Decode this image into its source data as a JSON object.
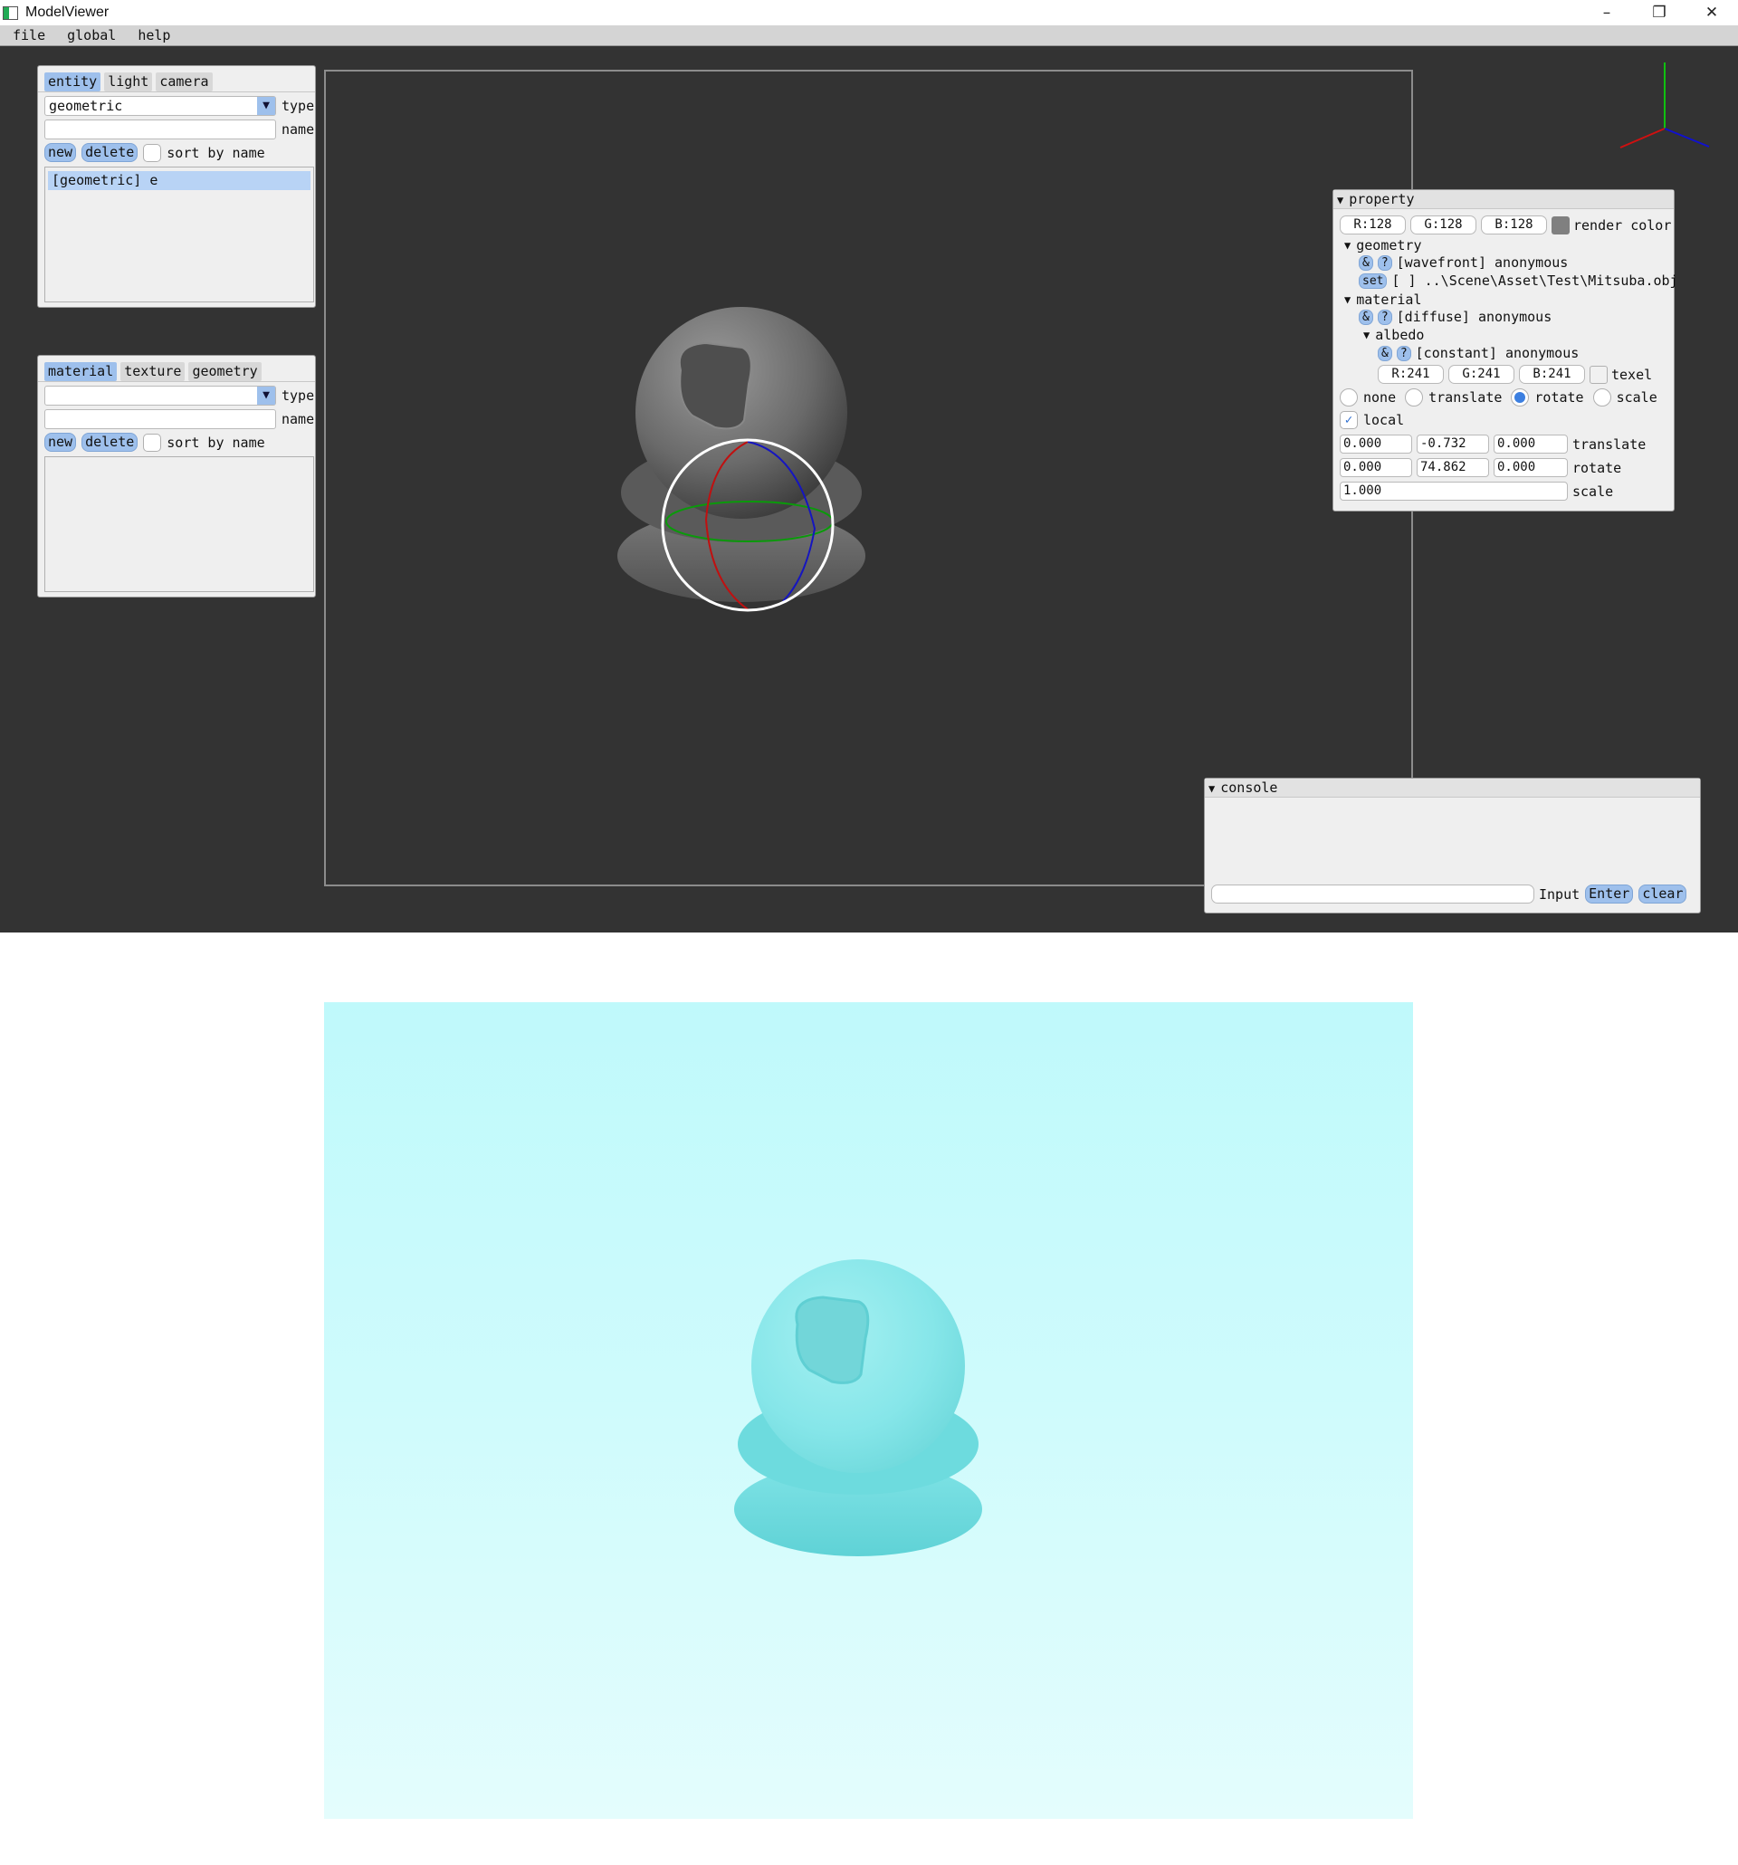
{
  "window": {
    "title": "ModelViewer",
    "controls": {
      "minimize": "–",
      "restore": "❐",
      "close": "✕"
    }
  },
  "menu": [
    "file",
    "global",
    "help"
  ],
  "entity_panel": {
    "tabs": [
      "entity",
      "light",
      "camera"
    ],
    "active_tab": "entity",
    "type_value": "geometric",
    "type_label": "type",
    "name_value": "",
    "name_label": "name",
    "new_label": "new",
    "delete_label": "delete",
    "sort_label": "sort by name",
    "sort_checked": false,
    "items": [
      "[geometric] e"
    ]
  },
  "resource_panel": {
    "tabs": [
      "material",
      "texture",
      "geometry"
    ],
    "active_tab": "material",
    "type_value": "",
    "type_label": "type",
    "name_value": "",
    "name_label": "name",
    "new_label": "new",
    "delete_label": "delete",
    "sort_label": "sort by name",
    "sort_checked": false
  },
  "property": {
    "title": "property",
    "render_color": {
      "r": "R:128",
      "g": "G:128",
      "b": "B:128",
      "swatch": "#808080",
      "label": "render color"
    },
    "geometry_label": "geometry",
    "geometry_ref": "&",
    "geometry_help": "?",
    "geometry_type": "[wavefront] anonymous",
    "set_label": "set",
    "geometry_path": "[ ] ..\\Scene\\Asset\\Test\\Mitsuba.obj",
    "material_label": "material",
    "material_ref": "&",
    "material_help": "?",
    "material_type": "[diffuse] anonymous",
    "albedo_label": "albedo",
    "albedo_ref": "&",
    "albedo_help": "?",
    "albedo_type": "[constant] anonymous",
    "albedo_color": {
      "r": "R:241",
      "g": "G:241",
      "b": "B:241",
      "swatch": "#f1f1f1",
      "label": "texel"
    },
    "modes": [
      "none",
      "translate",
      "rotate",
      "scale"
    ],
    "selected_mode": "rotate",
    "local_label": "local",
    "local_checked": true,
    "translate": [
      "0.000",
      "-0.732",
      "0.000"
    ],
    "translate_label": "translate",
    "rotate": [
      "0.000",
      "74.862",
      "0.000"
    ],
    "rotate_label": "rotate",
    "scale": "1.000",
    "scale_label": "scale"
  },
  "console": {
    "title": "console",
    "input_value": "",
    "input_label": "Input",
    "enter_label": "Enter",
    "clear_label": "clear"
  },
  "colors": {
    "app_bg": "#333333",
    "accent": "#9ec0ec",
    "render_bg": "#c8fafb",
    "model_gray": "#7a7a7a",
    "model_cyan": "#7fe3e6",
    "gizmo_x": "#d01010",
    "gizmo_y": "#10c010",
    "gizmo_z": "#1010d0"
  }
}
